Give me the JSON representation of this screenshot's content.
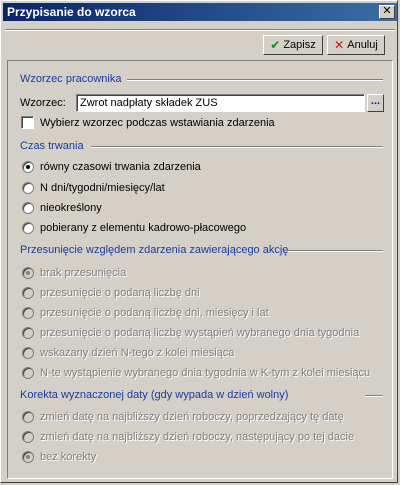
{
  "window": {
    "title": "Przypisanie do wzorca",
    "close_glyph": "✕"
  },
  "toolbar": {
    "save_label": "Zapisz",
    "cancel_label": "Anuluj",
    "save_icon": "checkmark-icon",
    "cancel_icon": "x-icon"
  },
  "wzorzec": {
    "section_title": "Wzorzec pracownika",
    "field_label": "Wzorzec:",
    "field_value": "Zwrot nadpłaty składek ZUS",
    "browse_label": "...",
    "checkbox_label": "Wybierz wzorzec podczas wstawiania zdarzenia"
  },
  "czas": {
    "section_title": "Czas trwania",
    "options": [
      {
        "label": "równy czasowi trwania zdarzenia",
        "selected": true
      },
      {
        "label": "N dni/tygodni/miesięcy/lat",
        "selected": false
      },
      {
        "label": "nieokreślony",
        "selected": false
      },
      {
        "label": "pobierany z elementu kadrowo-płacowego",
        "selected": false
      }
    ]
  },
  "przesuniecie": {
    "section_title": "Przesunięcie względem zdarzenia zawierającego akcję",
    "options": [
      {
        "label": "brak przesunięcia",
        "selected": true
      },
      {
        "label": "przesunięcie o podaną liczbę dni",
        "selected": false
      },
      {
        "label": "przesunięcie o podaną liczbę dni, miesięcy i lat",
        "selected": false
      },
      {
        "label": "przesunięcie o podaną liczbę wystąpień wybranego dnia tygodnia",
        "selected": false
      },
      {
        "label": "wskazany dzień N-tego z kolei miesiąca",
        "selected": false
      },
      {
        "label": "N-te wystąpienie wybranego dnia tygodnia w K-tym z kolei miesiącu",
        "selected": false
      }
    ]
  },
  "korekta": {
    "section_title": "Korekta wyznaczonej daty (gdy wypada w dzień wolny)",
    "options": [
      {
        "label": "zmień datę na najbliższy dzień roboczy, poprzedzający tę datę",
        "selected": false
      },
      {
        "label": "zmień datę na najbliższy dzień roboczy, następujący po tej dacie",
        "selected": false
      },
      {
        "label": "bez korekty",
        "selected": true
      }
    ]
  },
  "colors": {
    "section_text": "#1a3aa8",
    "titlebar_start": "#0a246a",
    "titlebar_end": "#3a6ea5"
  }
}
